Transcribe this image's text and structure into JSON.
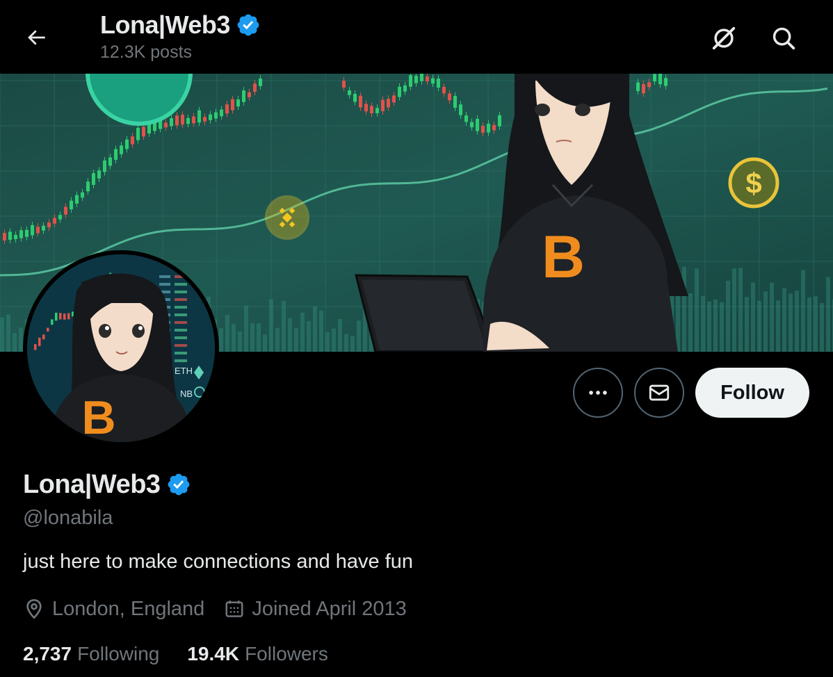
{
  "header": {
    "display_name": "Lona|Web3",
    "posts_count": "12.3K posts"
  },
  "profile": {
    "display_name": "Lona|Web3",
    "handle": "@lonabila",
    "bio": "just here to make connections and have fun",
    "location": "London, England",
    "joined": "Joined April 2013",
    "following_count": "2,737",
    "following_label": "Following",
    "followers_count": "19.4K",
    "followers_label": "Followers",
    "verified": true
  },
  "actions": {
    "follow_label": "Follow"
  },
  "banner": {
    "coin_symbol": "$",
    "hoodie_logo": "B"
  },
  "avatar": {
    "ticker_labels": [
      "ETH",
      "NB"
    ],
    "hoodie_logo": "B"
  },
  "icons": {
    "back": "arrow-left-icon",
    "grok": "grok-icon",
    "search": "search-icon",
    "more": "more-icon",
    "message": "envelope-icon",
    "verified": "verified-badge-icon",
    "location": "location-pin-icon",
    "calendar": "calendar-icon"
  },
  "colors": {
    "background": "#000000",
    "text_primary": "#e7e9ea",
    "text_secondary": "#71767b",
    "verified_blue": "#1d9bf0",
    "follow_button_bg": "#eff3f4",
    "banner_bg": "#1c5049",
    "candle_up": "#2ecc71",
    "candle_down": "#e0524a",
    "bitcoin_orange": "#f7931a"
  }
}
